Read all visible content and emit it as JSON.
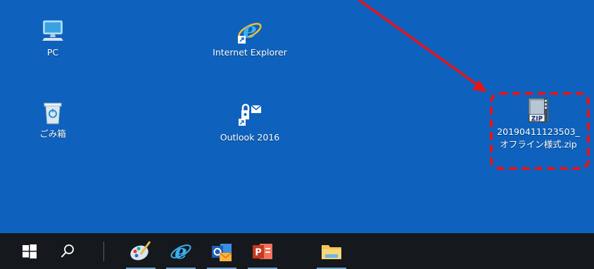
{
  "desktop": {
    "background": "#0e62bd",
    "icons": [
      {
        "label": "PC",
        "icon": "pc-icon"
      },
      {
        "label": "Internet Explorer",
        "icon": "internet-explorer-icon"
      },
      {
        "label": "ごみ箱",
        "icon": "recycle-bin-icon"
      },
      {
        "label": "Outlook 2016",
        "icon": "outlook-icon"
      },
      {
        "label_line1": "20190411123503_",
        "label_line2": "オフライン様式.zip",
        "icon": "zip-file-icon"
      }
    ]
  },
  "annotation": {
    "arrow_color": "#e8121a",
    "box_color": "#e8121a"
  },
  "taskbar": {
    "background": "#15181d",
    "items": [
      {
        "name": "start",
        "icon": "windows-logo-icon"
      },
      {
        "name": "search",
        "icon": "search-icon"
      },
      {
        "name": "paint",
        "icon": "paint-icon"
      },
      {
        "name": "internet-explorer",
        "icon": "internet-explorer-icon"
      },
      {
        "name": "outlook",
        "icon": "outlook-icon"
      },
      {
        "name": "powerpoint",
        "icon": "powerpoint-icon"
      },
      {
        "name": "file-explorer",
        "icon": "folder-icon"
      }
    ]
  }
}
